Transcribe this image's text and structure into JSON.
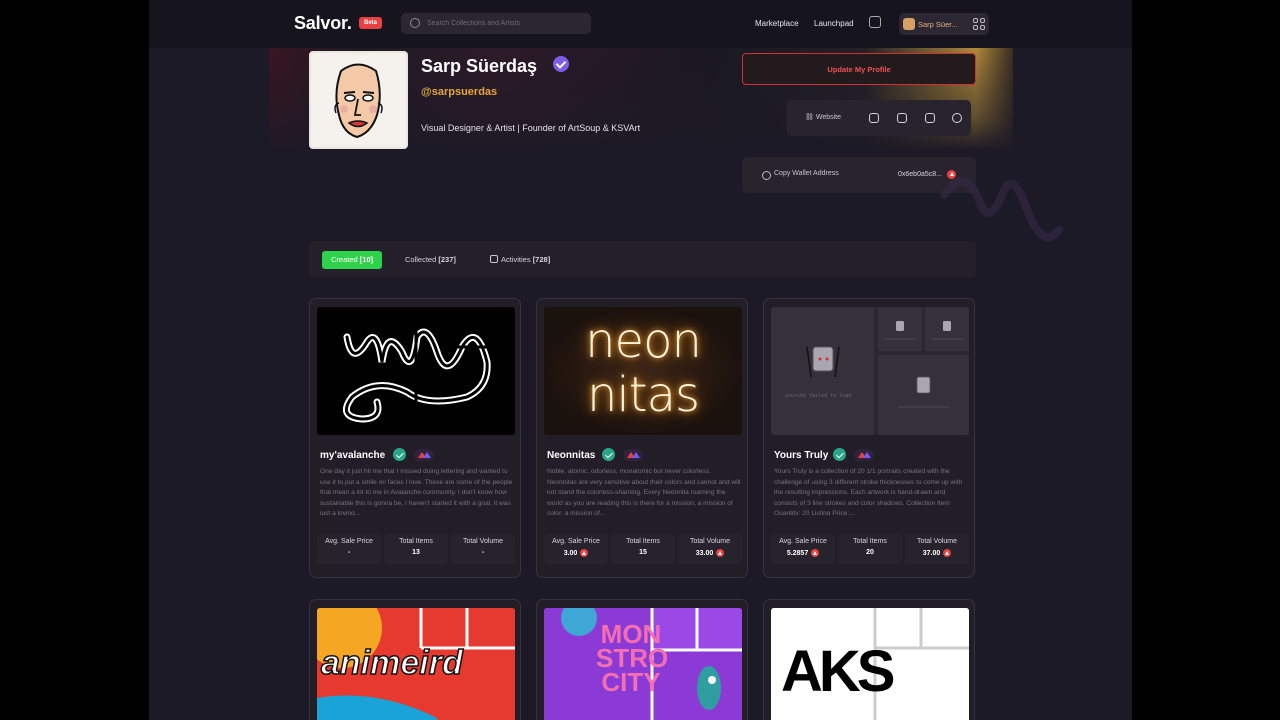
{
  "nav": {
    "logo": "Salvor.",
    "beta_badge": "Beta",
    "search_placeholder": "Search Collections and Artists",
    "links": [
      "Marketplace",
      "Launchpad"
    ],
    "user_name": "Sarp Süer..."
  },
  "profile": {
    "name": "Sarp Süerdaş",
    "handle": "@sarpsuerdas",
    "bio": "Visual Designer & Artist | Founder of ArtSoup & KSVArt",
    "update_button": "Update My Profile",
    "website_label": "Website",
    "social_icons": [
      "twitter-icon",
      "discord-icon",
      "instagram-icon",
      "refresh-icon"
    ],
    "copy_wallet_label": "Copy Wallet Address",
    "wallet_address": "0x6eb0a5c8..."
  },
  "tabs": [
    {
      "label": "Created",
      "count": "[10]",
      "active": true
    },
    {
      "label": "Collected",
      "count": "[237]",
      "active": false
    },
    {
      "label": "Activities",
      "count": "[728]",
      "active": false
    }
  ],
  "stat_labels": {
    "avg": "Avg. Sale Price",
    "items": "Total Items",
    "volume": "Total Volume"
  },
  "collections": [
    {
      "title": "my'avalanche",
      "description": "One day it just hit me that I missed doing lettering and wanted to use it to put a smile on faces I love. These are some of the people that mean a lot to me in Avalanche community. I don't know how sustainable this is gonna be, I haven't started it with a goal, it was just a loving...",
      "avg_price": "-",
      "total_items": "13",
      "total_volume": "-"
    },
    {
      "title": "Neonnitas",
      "description": "Noble, atomic, odorless, monatomic but never colorless. Neonnitas are very sensitive about their colors and cannot and will not stand the colorless-shaming. Every Neonnita roaming the world as you are reading this is there for a mission, a mission of color, a mission of...",
      "avg_price": "3.00",
      "total_items": "15",
      "total_volume": "33.00",
      "thumb_text_1": "neon",
      "thumb_text_2": "nitas"
    },
    {
      "title": "Yours Truly",
      "description": "Yours Truly is a collection of 20 1/1 portraits created with the challenge of using 3 different stroke thicknesses to come up with the resulting impressions. Each artwork is hand-drawn and consists of 3 line strokes and color shadows. Collection Item Quantity: 20 Listing Price:...",
      "avg_price": "5.2857",
      "total_items": "20",
      "total_volume": "37.00",
      "thumb_fail_text": "yourskb failed to load"
    }
  ],
  "second_row_thumbs": [
    "animeird",
    "MON STRO CITY",
    "AKS"
  ],
  "colors": {
    "accent_green": "#2ed14a",
    "avax_red": "#e84142",
    "handle_orange": "#e7a63a",
    "verified_purple": "#7d5ce8"
  }
}
